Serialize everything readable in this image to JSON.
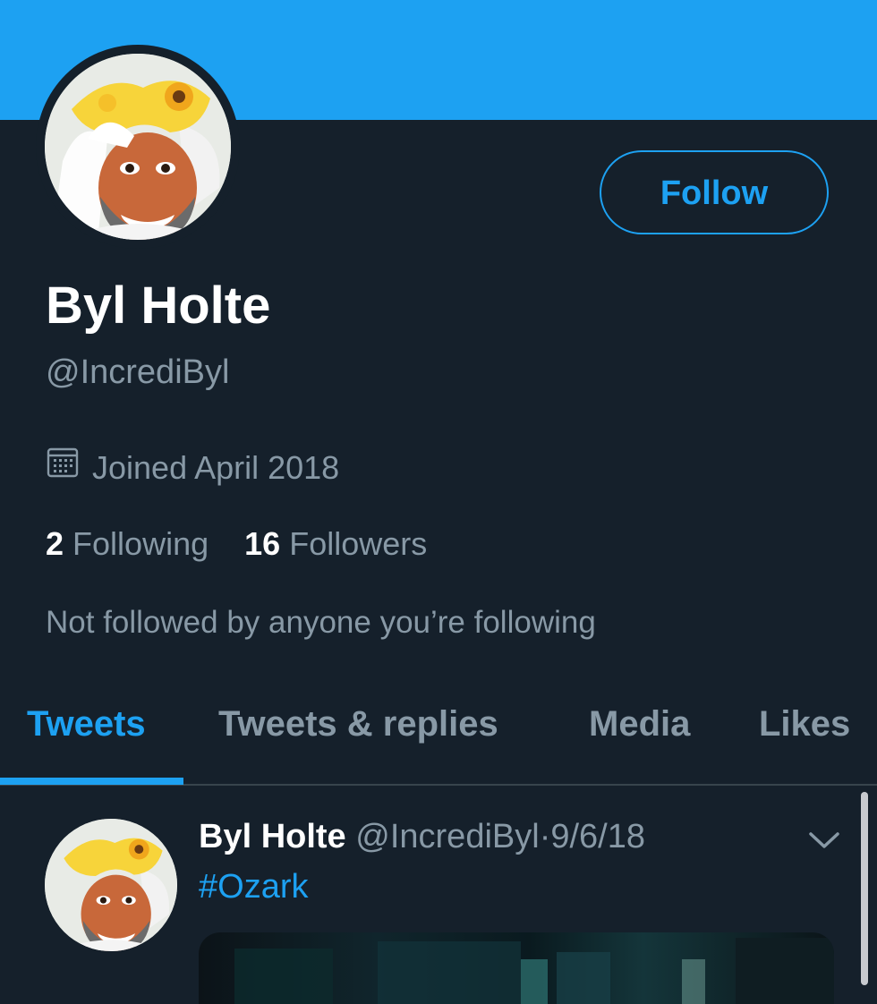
{
  "profile": {
    "name": "Byl Holte",
    "handle": "@IncrediByl",
    "joined": "Joined April 2018",
    "following_count": "2",
    "following_label": "Following",
    "followers_count": "16",
    "followers_label": "Followers",
    "mutuals_note": "Not followed by anyone you’re following"
  },
  "actions": {
    "follow_label": "Follow"
  },
  "tabs": [
    {
      "label": "Tweets",
      "active": true
    },
    {
      "label": "Tweets & replies",
      "active": false
    },
    {
      "label": "Media",
      "active": false
    },
    {
      "label": "Likes",
      "active": false
    }
  ],
  "tweet": {
    "name": "Byl Holte",
    "handle": "@IncrediByl",
    "separator": "·",
    "date": "9/6/18",
    "text": "#Ozark"
  },
  "icons": {
    "calendar": "calendar-icon",
    "chevron": "chevron-down-icon"
  },
  "colors": {
    "background": "#15202b",
    "accent": "#1da1f2",
    "secondary_text": "#8899a6",
    "primary_text": "#ffffff",
    "divider": "#38444d"
  }
}
